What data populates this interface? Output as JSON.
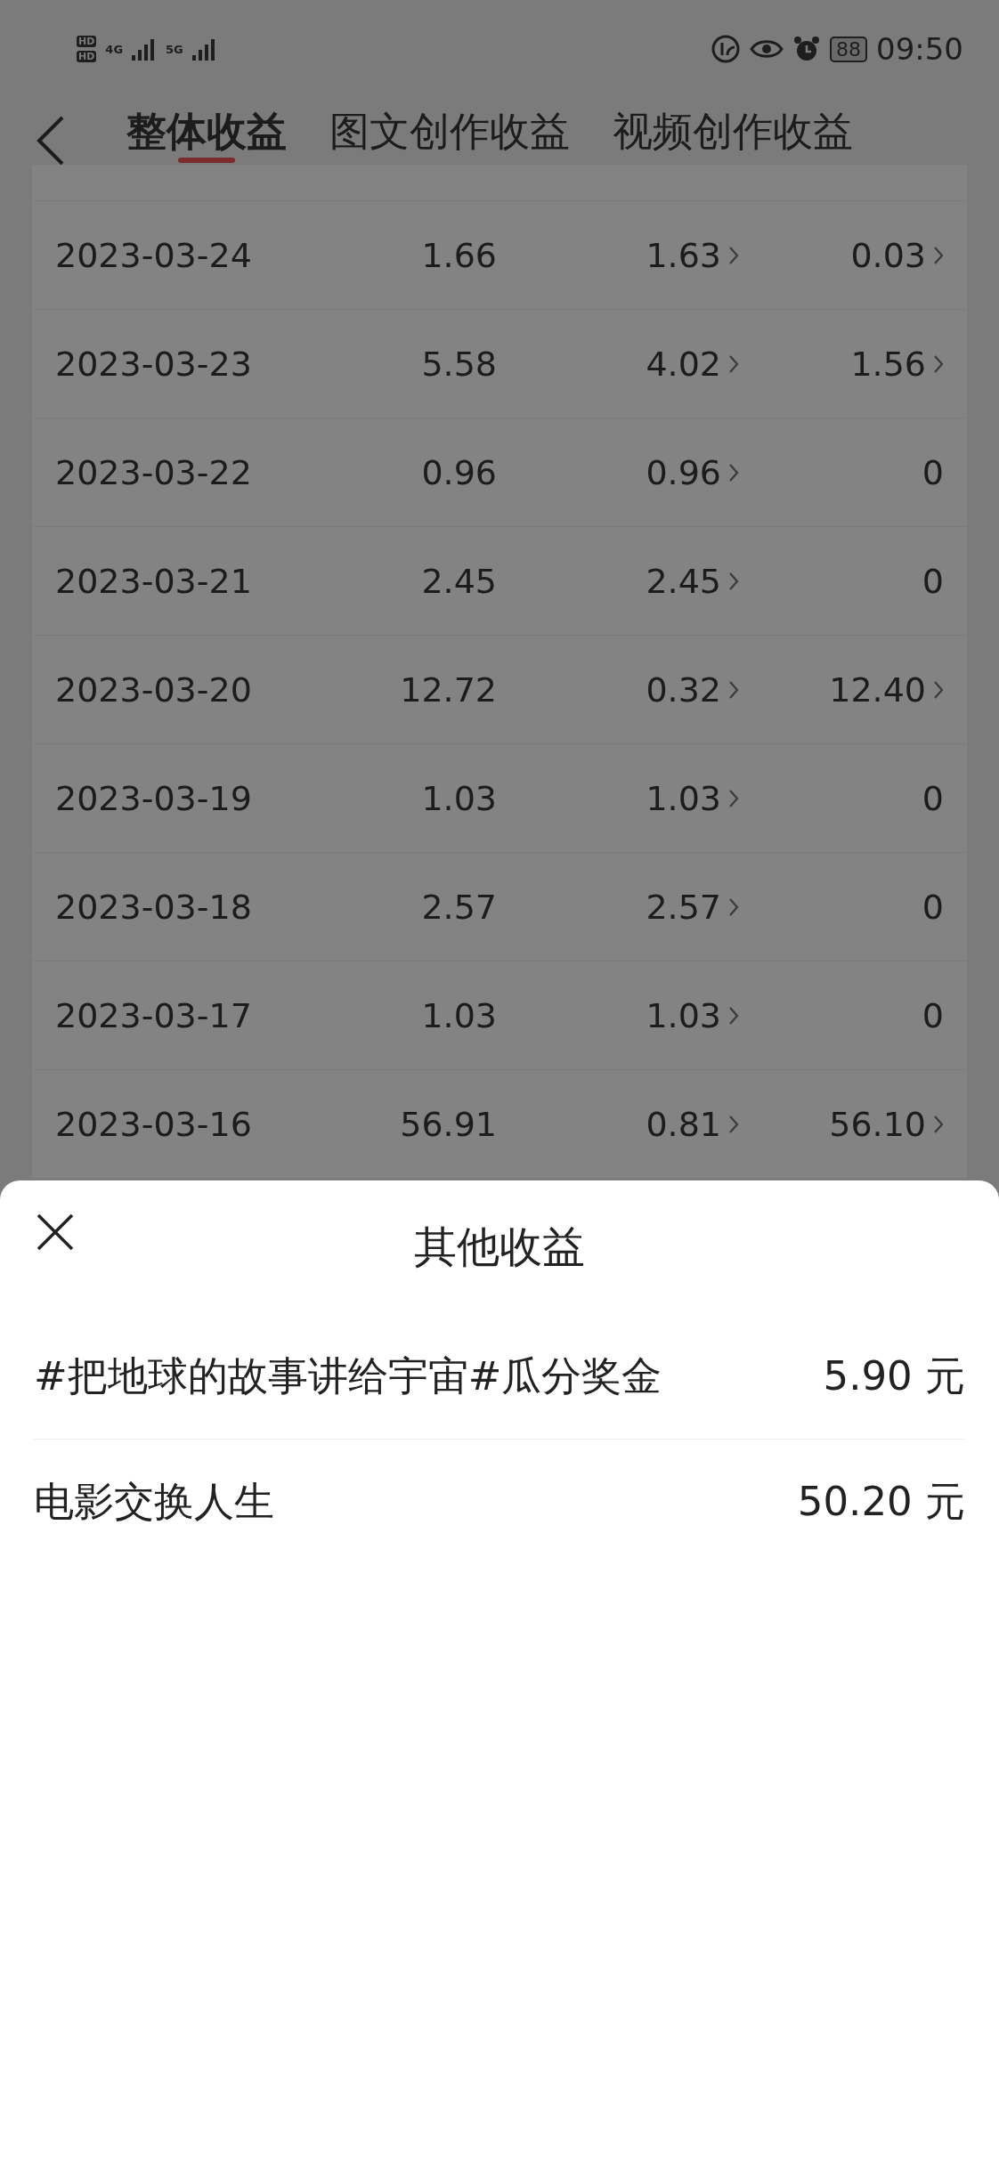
{
  "status_bar": {
    "sim_labels": [
      "HD",
      "HD"
    ],
    "networks": [
      "4G",
      "5G"
    ],
    "battery": "88",
    "time": "09:50"
  },
  "tabs": [
    {
      "label": "整体收益",
      "selected": true
    },
    {
      "label": "图文创作收益",
      "selected": false
    },
    {
      "label": "视频创作收益",
      "selected": false
    }
  ],
  "table": {
    "rows": [
      {
        "date": "2023-03-24",
        "total": "1.66",
        "article": {
          "value": "1.63",
          "link": true
        },
        "video": {
          "value": "0.03",
          "link": true
        }
      },
      {
        "date": "2023-03-23",
        "total": "5.58",
        "article": {
          "value": "4.02",
          "link": true
        },
        "video": {
          "value": "1.56",
          "link": true
        }
      },
      {
        "date": "2023-03-22",
        "total": "0.96",
        "article": {
          "value": "0.96",
          "link": true
        },
        "video": {
          "value": "0",
          "link": false
        }
      },
      {
        "date": "2023-03-21",
        "total": "2.45",
        "article": {
          "value": "2.45",
          "link": true
        },
        "video": {
          "value": "0",
          "link": false
        }
      },
      {
        "date": "2023-03-20",
        "total": "12.72",
        "article": {
          "value": "0.32",
          "link": true
        },
        "video": {
          "value": "12.40",
          "link": true
        }
      },
      {
        "date": "2023-03-19",
        "total": "1.03",
        "article": {
          "value": "1.03",
          "link": true
        },
        "video": {
          "value": "0",
          "link": false
        }
      },
      {
        "date": "2023-03-18",
        "total": "2.57",
        "article": {
          "value": "2.57",
          "link": true
        },
        "video": {
          "value": "0",
          "link": false
        }
      },
      {
        "date": "2023-03-17",
        "total": "1.03",
        "article": {
          "value": "1.03",
          "link": true
        },
        "video": {
          "value": "0",
          "link": false
        }
      },
      {
        "date": "2023-03-16",
        "total": "56.91",
        "article": {
          "value": "0.81",
          "link": true
        },
        "video": {
          "value": "56.10",
          "link": true
        }
      }
    ]
  },
  "sheet": {
    "title": "其他收益",
    "items": [
      {
        "label": "#把地球的故事讲给宇宙#瓜分奖金",
        "amount": "5.90 元"
      },
      {
        "label": "电影交换人生",
        "amount": "50.20 元"
      }
    ]
  }
}
